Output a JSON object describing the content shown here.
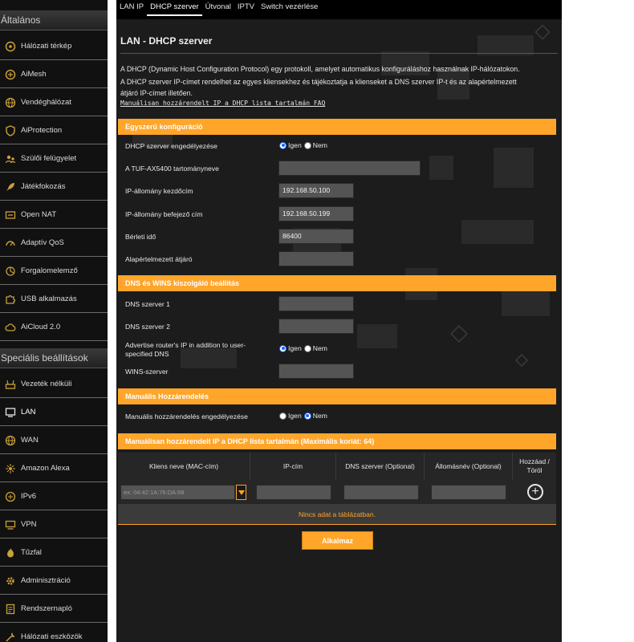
{
  "colors": {
    "accent": "#ffa52a",
    "bg": "#1c1c1c",
    "sidebar": "#111111"
  },
  "sidebar": {
    "general_title": "Általános",
    "general_items": [
      {
        "label": "Hálózati térkép",
        "icon": "network-map-icon"
      },
      {
        "label": "AiMesh",
        "icon": "aimesh-icon"
      },
      {
        "label": "Vendéghálózat",
        "icon": "globe-icon"
      },
      {
        "label": "AiProtection",
        "icon": "shield-icon"
      },
      {
        "label": "Szülői felügyelet",
        "icon": "parental-control-icon"
      },
      {
        "label": "Játékfokozás",
        "icon": "rocket-icon"
      },
      {
        "label": "Open NAT",
        "icon": "open-nat-icon"
      },
      {
        "label": "Adaptív QoS",
        "icon": "gauge-icon"
      },
      {
        "label": "Forgalomelemző",
        "icon": "traffic-analyzer-icon"
      },
      {
        "label": "USB alkalmazás",
        "icon": "puzzle-icon"
      },
      {
        "label": "AiCloud 2.0",
        "icon": "cloud-icon"
      }
    ],
    "advanced_title": "Speciális beállítások",
    "advanced_items": [
      {
        "label": "Vezeték nélküli",
        "icon": "wifi-icon"
      },
      {
        "label": "LAN",
        "icon": "lan-icon"
      },
      {
        "label": "WAN",
        "icon": "globe-icon"
      },
      {
        "label": "Amazon Alexa",
        "icon": "alexa-icon"
      },
      {
        "label": "IPv6",
        "icon": "ipv6-icon"
      },
      {
        "label": "VPN",
        "icon": "vpn-icon"
      },
      {
        "label": "Tűzfal",
        "icon": "firewall-icon"
      },
      {
        "label": "Adminisztráció",
        "icon": "gear-icon"
      },
      {
        "label": "Rendszernapló",
        "icon": "log-icon"
      },
      {
        "label": "Hálózati eszközök",
        "icon": "tools-icon"
      }
    ]
  },
  "tabs": [
    "LAN IP",
    "DHCP szerver",
    "Útvonal",
    "IPTV",
    "Switch vezérlése"
  ],
  "page": {
    "title": "LAN - DHCP szerver",
    "desc1": "A DHCP (Dynamic Host Configuration Protocol) egy protokoll, amelyet automatikus konfiguráláshoz használnak IP-hálózatokon.",
    "desc2": "A DHCP szerver IP-címet rendelhet az egyes kliensekhez és tájékoztatja a klienseket a DNS szerver IP-t és az alapértelmezett",
    "desc3": "átjáró IP-címet illetően.",
    "faq_link": "Manuálisan hozzárendelt IP a DHCP lista tartalmán FAQ"
  },
  "basic": {
    "header": "Egyszerű konfiguráció",
    "enable_label": "DHCP szerver engedélyezése",
    "yes": "Igen",
    "no": "Nem",
    "domain_label": "A TUF-AX5400 tartománynevе",
    "domain_value": "",
    "start_label": "IP-állomány kezdőcím",
    "start_value": "192.168.50.100",
    "end_label": "IP-állomány befejező cím",
    "end_value": "192.168.50.199",
    "lease_label": "Bérleti idő",
    "lease_value": "86400",
    "gateway_label": "Alapértelmezett átjáró",
    "gateway_value": ""
  },
  "dns": {
    "header": "DNS és WINS kiszolgáló beállítás",
    "dns1_label": "DNS szerver 1",
    "dns1_value": "",
    "dns2_label": "DNS szerver 2",
    "dns2_value": "",
    "advertise_label_1": "Advertise router's IP in addition to user-",
    "advertise_label_2": "specified DNS",
    "wins_label": "WINS-szerver",
    "wins_value": ""
  },
  "manual": {
    "header": "Manuális Hozzárendelés",
    "enable_label": "Manuális hozzárendelés engedélyezése"
  },
  "list": {
    "header": "Manuálisan hozzárendelt IP a DHCP lista tartalmán (Maximális korlát: 64)",
    "col_client": "Kliens neve (MAC-cím)",
    "col_ip": "IP-cím",
    "col_dns": "DNS szerver (Optional)",
    "col_host": "Állomásnév (Optional)",
    "col_add1": "Hozzáad /",
    "col_add2": "Töröl",
    "mac_placeholder": "ex: 04:42:1A:76:DA:68",
    "empty": "Nincs adat a táblázatban."
  },
  "apply_label": "Alkalmaz"
}
